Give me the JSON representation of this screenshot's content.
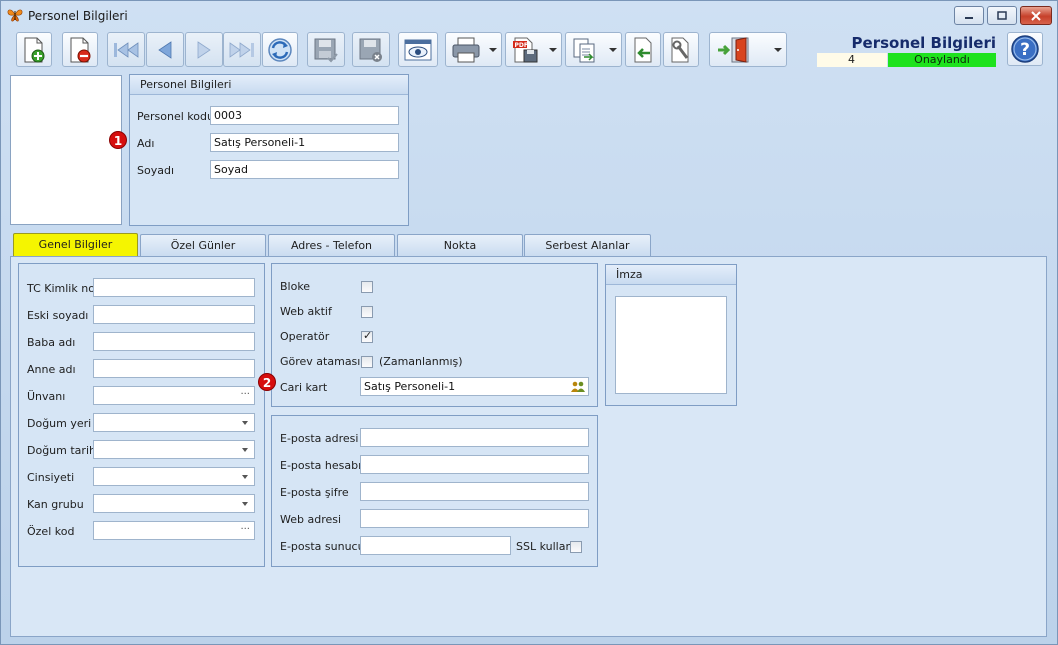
{
  "window": {
    "title": "Personel Bilgileri",
    "minimize_icon": "minimize-icon",
    "maximize_icon": "maximize-icon",
    "close_icon": "close-icon"
  },
  "toolbar": {
    "buttons": [
      "new-doc-icon",
      "delete-doc-icon",
      "first-record-icon",
      "prev-record-icon",
      "next-record-icon",
      "last-record-icon",
      "refresh-icon",
      "save-icon",
      "save-discard-icon",
      "preview-icon",
      "print-icon",
      "pdf-icon",
      "export-icon",
      "import-icon",
      "settings-icon",
      "exit-door-icon"
    ]
  },
  "header": {
    "title": "Personel Bilgileri",
    "count": "4",
    "status": "Onaylandı",
    "status_color": "#1ee21e",
    "help_icon": "help-icon"
  },
  "personnel": {
    "group_title": "Personel Bilgileri",
    "code_label": "Personel kodu",
    "code_value": "0003",
    "name_label": "Adı",
    "name_value": "Satış Personeli-1",
    "surname_label": "Soyadı",
    "surname_value": "Soyad",
    "badge1": "1"
  },
  "tabs": [
    {
      "label": "Genel Bilgiler",
      "active": true
    },
    {
      "label": "Özel Günler"
    },
    {
      "label": "Adres - Telefon"
    },
    {
      "label": "Nokta"
    },
    {
      "label": "Serbest Alanlar"
    }
  ],
  "general": {
    "tc_label": "TC Kimlik no",
    "old_surname_label": "Eski soyadı",
    "father_label": "Baba adı",
    "mother_label": "Anne adı",
    "title_label": "Ünvanı",
    "birthplace_label": "Doğum yeri",
    "birthdate_label": "Doğum tarihi",
    "gender_label": "Cinsiyeti",
    "blood_label": "Kan grubu",
    "special_code_label": "Özel kod",
    "ellipsis": "···"
  },
  "flags": {
    "block_label": "Bloke",
    "web_active_label": "Web aktif",
    "operator_label": "Operatör",
    "task_label": "Görev ataması",
    "scheduled_label": "(Zamanlanmış)",
    "account_label": "Cari kart",
    "account_value": "Satış Personeli-1",
    "account_icon": "people-lookup-icon",
    "badge2": "2",
    "checkmark": "✓"
  },
  "email": {
    "address_label": "E-posta adresi",
    "account_label": "E-posta hesabı",
    "password_label": "E-posta şifre",
    "web_label": "Web adresi",
    "server_label": "E-posta sunucu",
    "ssl_label": "SSL kullan"
  },
  "signature": {
    "title": "İmza"
  }
}
